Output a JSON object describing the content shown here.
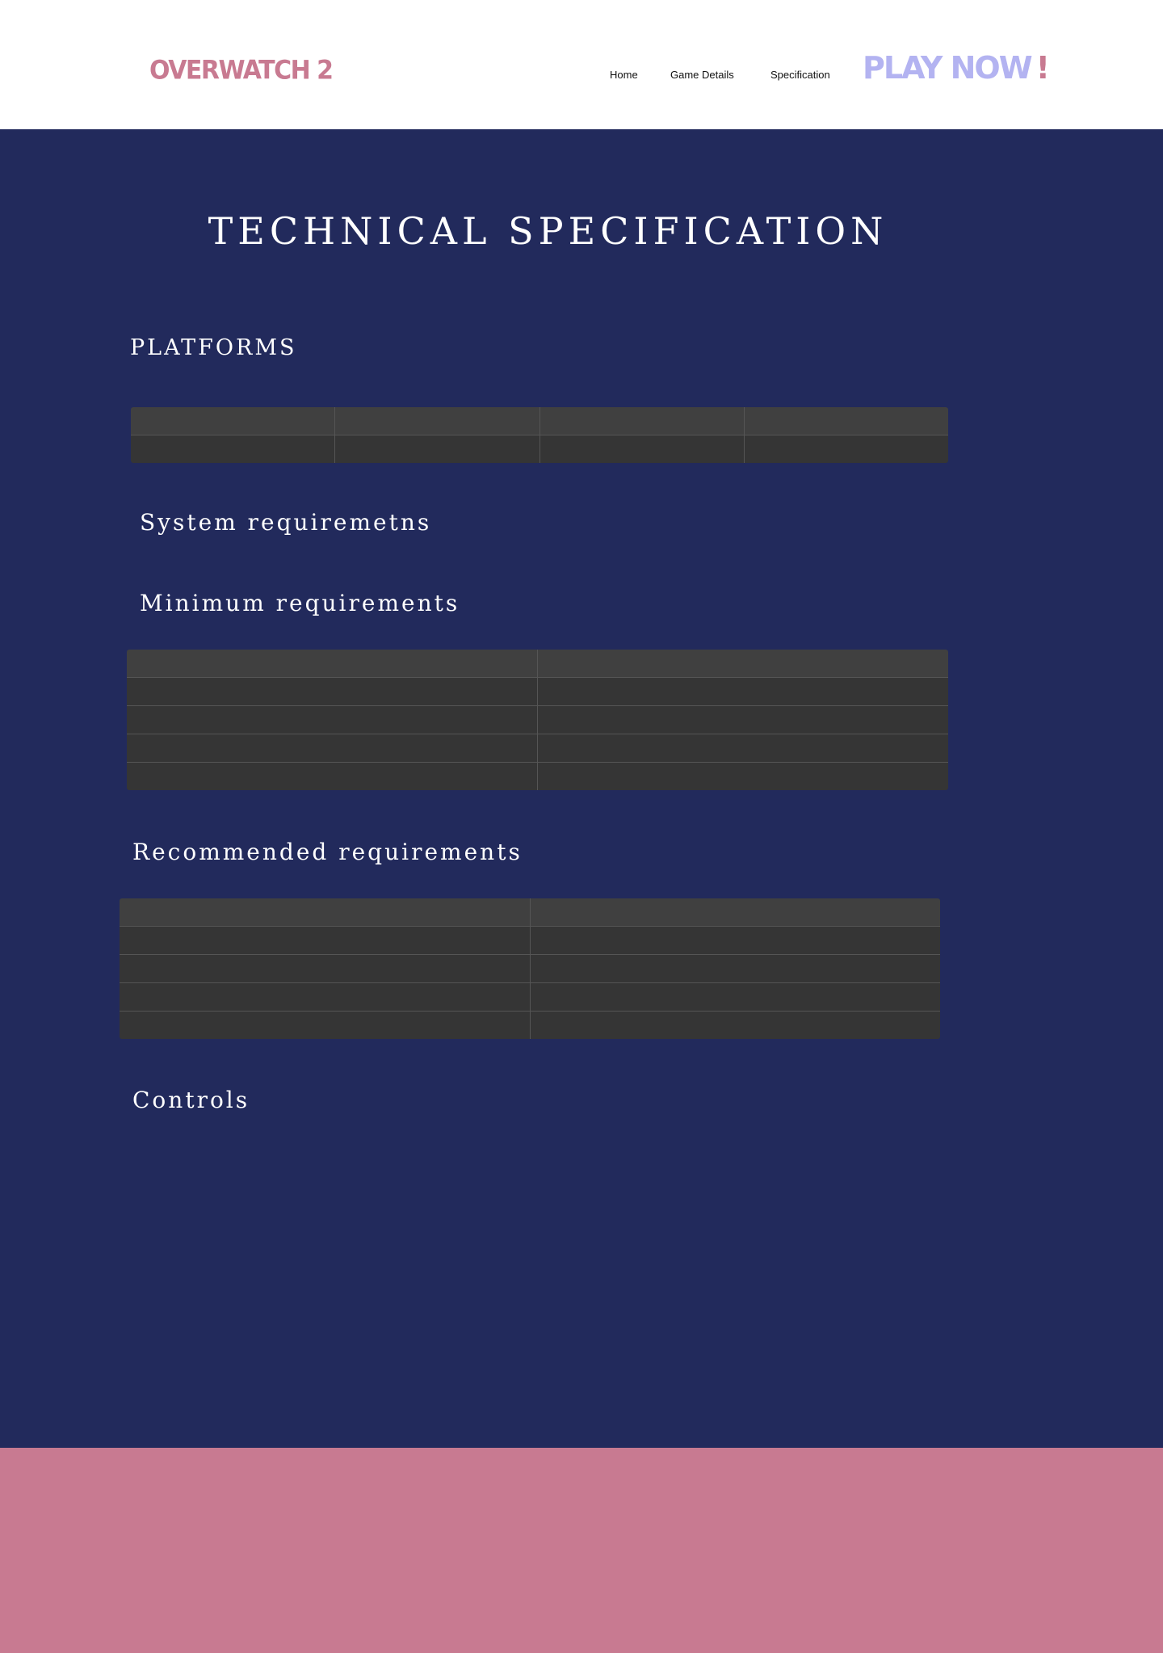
{
  "header": {
    "logo": "OVERWATCH 2",
    "nav": [
      "Home",
      "Game Details",
      "Specification"
    ],
    "cta_main": "PLAY NOW",
    "cta_bang": "!"
  },
  "page": {
    "title": "TECHNICAL SPECIFICATION"
  },
  "sections": {
    "platforms": "PLATFORMS",
    "system_requirements": "System requiremetns",
    "minimum_requirements": "Minimum requirements",
    "recommended_requirements": "Recommended requirements",
    "controls": "Controls"
  },
  "colors": {
    "header_bg": "#ffffff",
    "page_bg": "#222a5c",
    "accent_pink": "#c87a91",
    "accent_lavender": "#b3b3f1",
    "table_header_bg": "#404040",
    "table_row_bg": "#353535"
  }
}
